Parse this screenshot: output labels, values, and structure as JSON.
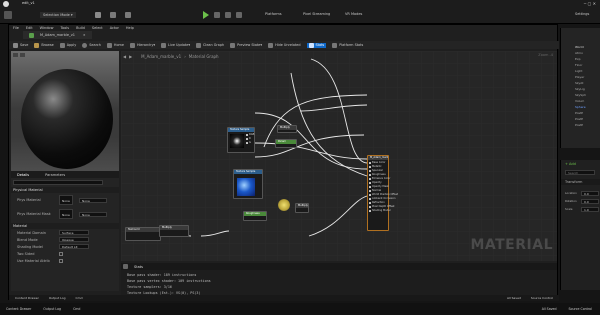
{
  "tabs": {
    "project": "edit_v1"
  },
  "menu": [
    "File",
    "Edit",
    "Window",
    "Tools",
    "Build",
    "Select",
    "Actor",
    "Help"
  ],
  "main_toolbar": {
    "selection_mode": "Selection Mode",
    "platforms": "Platforms",
    "pixel_streaming": "Pixel Streaming",
    "vr_modes": "VR Modes",
    "settings": "Settings"
  },
  "material_tab": {
    "title": "M_Adam_marble_v1"
  },
  "editor_toolbar": [
    "Save",
    "Browse",
    "Apply",
    "Search",
    "Home",
    "Hierarchy",
    "Live Update",
    "Clean Graph",
    "Preview State",
    "Hide Unrelated",
    "Stats",
    "Platform Stats"
  ],
  "breadcrumb": {
    "asset": "M_Adam_marble_v1",
    "graph": "Material Graph"
  },
  "graph": {
    "watermark": "MATERIAL",
    "zoom": "Zoom -4"
  },
  "details": {
    "tab_details": "Details",
    "tab_parameters": "Parameters",
    "section_physical": "Physical Material",
    "phys_label": "Phys Material",
    "phys_mask_label": "Phys Material Mask",
    "none": "None",
    "section_material": "Material",
    "rows": [
      {
        "label": "Material Domain",
        "value": "Surface"
      },
      {
        "label": "Blend Mode",
        "value": "Opaque"
      },
      {
        "label": "Shading Model",
        "value": "Default Lit"
      },
      {
        "label": "Two Sided",
        "value": ""
      },
      {
        "label": "Use Material Attrib",
        "value": ""
      }
    ]
  },
  "stats": {
    "title": "Stats",
    "lines": [
      "Base pass shader: 189 instructions",
      "Base pass vertex shader: 109 instructions",
      "Texture samplers: 3/16",
      "Texture Lookups (Est.): VS(0), PS(3)"
    ]
  },
  "nodes": {
    "result": {
      "title": "M_Adam_marble_v1",
      "pins": [
        "Base Color",
        "Metallic",
        "Specular",
        "Roughness",
        "Anisotropy",
        "Emissive Color",
        "Opacity",
        "Opacity Mask",
        "Normal",
        "Tangent",
        "World Position Offset",
        "Subsurface Color",
        "Custom Data 0",
        "Custom Data 1",
        "Ambient Occlusion",
        "Refraction",
        "Pixel Depth Offset",
        "Shading Model"
      ]
    },
    "tex1": {
      "title": "Texture Sample",
      "pins": [
        "UVs",
        "RGB",
        "R",
        "G",
        "B",
        "A"
      ]
    },
    "tex2": {
      "title": "Texture Sample",
      "pins": [
        "UVs",
        "RGB",
        "R",
        "G"
      ]
    },
    "multiply1": {
      "title": "Multiply"
    },
    "multiply2": {
      "title": "Multiply"
    },
    "param1": {
      "title": "Param"
    },
    "param2": {
      "title": "Roughness"
    },
    "coord": {
      "title": "TexCoord"
    }
  },
  "right_panel": {
    "outliner": [
      "World",
      "Atmo",
      "Exp",
      "Floor",
      "Light",
      "Player",
      "SkyAt",
      "SkyLig",
      "SkySph",
      "Volum",
      "Sphere",
      "PostP",
      "PostP",
      "PostP",
      "PostP",
      "PostP"
    ],
    "add": "+ Add",
    "search": "Search",
    "transform_header": "Transform",
    "fields": [
      "Location",
      "Rotation",
      "Scale"
    ],
    "values": [
      "0.0",
      "0.0",
      "1.0"
    ]
  },
  "bottom_bar": {
    "content_drawer": "Content Drawer",
    "output_log": "Output Log",
    "cmd": "Cmd",
    "all_saved": "All Saved",
    "source_control": "Source Control"
  },
  "colors": {
    "accent": "#0f68c8",
    "play": "#6cc04a",
    "result_node": "#b07020",
    "texture_node": "#2c5e8c",
    "constant_node": "#4a8a3a",
    "math_node": "#3a3a3a",
    "cursor": "#e0d05a"
  }
}
